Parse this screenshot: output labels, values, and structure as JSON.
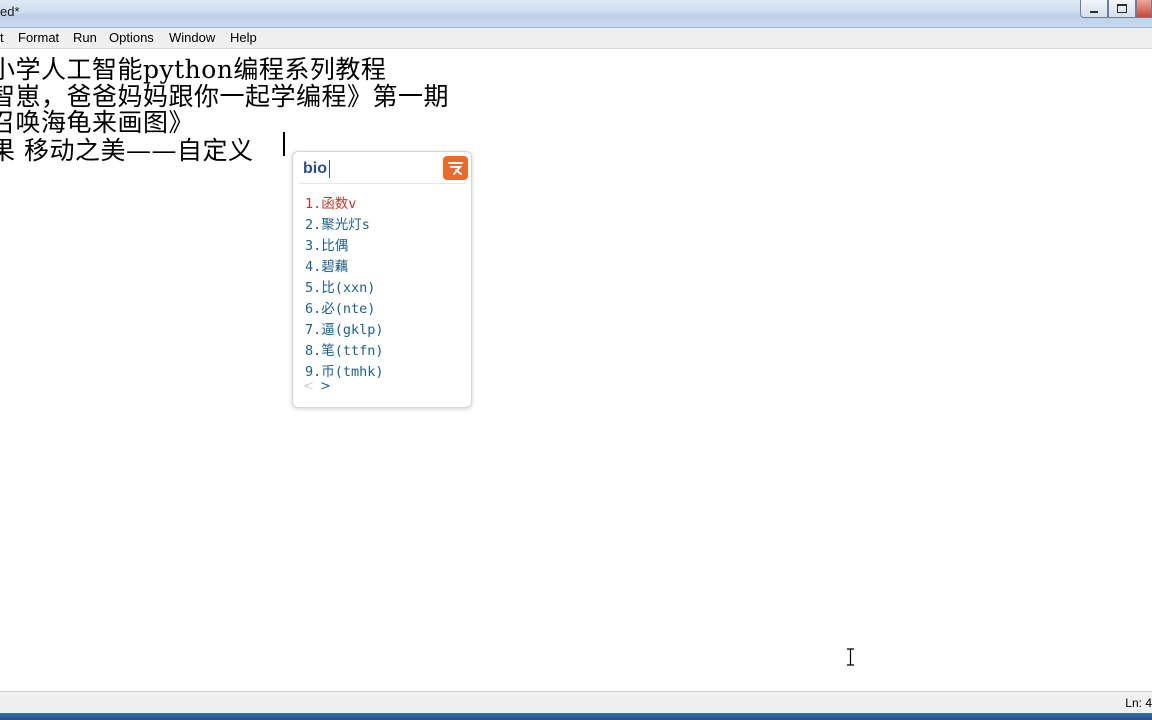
{
  "window": {
    "title": "ed*"
  },
  "menu": {
    "items": [
      "t",
      "Format",
      "Run",
      "Options",
      "Window",
      "Help"
    ]
  },
  "editor": {
    "lines": [
      "小学人工智能python编程系列教程",
      "智崽，爸爸妈妈跟你一起学编程》第一期",
      "召唤海龟来画图》",
      "果 移动之美——自定义"
    ]
  },
  "ime": {
    "composition": "bio",
    "candidates": [
      "1.函数v",
      "2.聚光灯s",
      "3.比偶",
      "4.碧藕",
      "5.比(xxn)",
      "6.必(nte)",
      "7.逼(gklp)",
      "8.笔(ttfn)",
      "9.币(tmhk)"
    ],
    "selected_index": 0,
    "selected_color": "#c0392b",
    "candidate_color": "#1f5f8a",
    "logo_color": "#ea6a2c",
    "pager_prev": "<",
    "pager_next": ">"
  },
  "status": {
    "position": "Ln: 4"
  }
}
